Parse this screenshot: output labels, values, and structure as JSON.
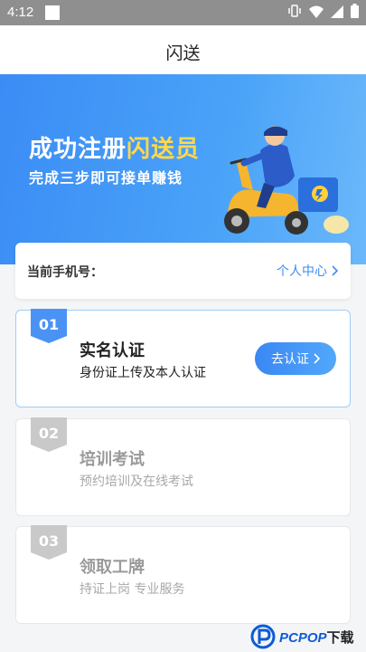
{
  "status_bar": {
    "time": "4:12"
  },
  "header": {
    "title": "闪送"
  },
  "banner": {
    "title_main": "成功注册",
    "title_highlight": "闪送员",
    "subtitle": "完成三步即可接单赚钱"
  },
  "phone_card": {
    "label": "当前手机号：",
    "link_label": "个人中心"
  },
  "steps": [
    {
      "number": "01",
      "title": "实名认证",
      "description": "身份证上传及本人认证",
      "button_label": "去认证"
    },
    {
      "number": "02",
      "title": "培训考试",
      "description": "预约培训及在线考试"
    },
    {
      "number": "03",
      "title": "领取工牌",
      "description": "持证上岗 专业服务"
    }
  ],
  "watermark": {
    "brand": "PCPOP",
    "suffix": "下载"
  },
  "colors": {
    "accent": "#3b8cf5",
    "highlight": "#ffd84d"
  }
}
